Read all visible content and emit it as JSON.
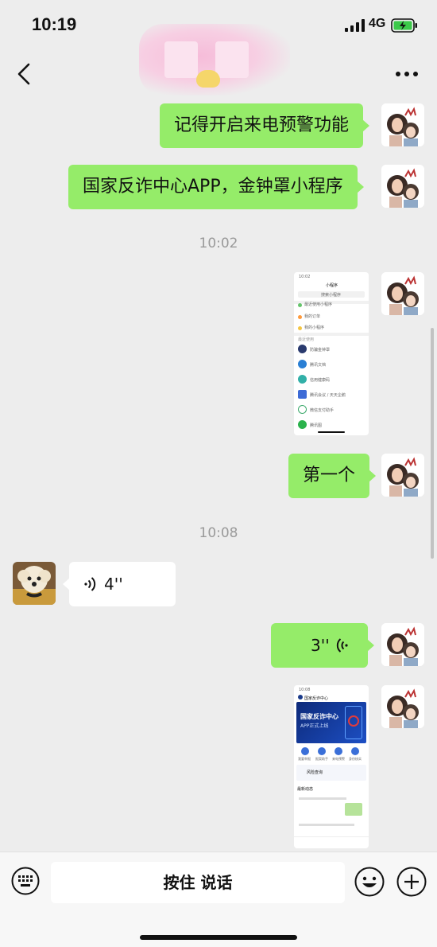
{
  "status_bar": {
    "time": "10:19",
    "network": "4G"
  },
  "header": {
    "back_icon": "chevron-left-icon",
    "more_icon": "ellipsis-icon"
  },
  "messages": [
    {
      "text": "记得开启来电预警功能"
    },
    {
      "text": "国家反诈中心APP，金钟罩小程序"
    },
    {
      "timestamp": "10:02"
    },
    {
      "text": "第一个"
    },
    {
      "timestamp": "10:08"
    },
    {
      "voice_duration": "4''"
    },
    {
      "voice_duration": "3''"
    }
  ],
  "shot1": {
    "time": "10:02",
    "title": "小程序",
    "search": "搜索小程序",
    "items": [
      "最近使用小程序",
      "我的订单",
      "我的小程序"
    ],
    "section": "最近使用",
    "apps": [
      "防骗金钟罩",
      "腾讯文档",
      "信用健康码",
      "腾讯会议 / 天天企鹅",
      "微信支付助手",
      "腾讯图"
    ]
  },
  "shot2": {
    "time": "10:08",
    "title": "国家反诈中心",
    "banner_title": "国家反诈中心",
    "banner_sub": "APP正式上线",
    "tiles": [
      "我要举报",
      "报案助手",
      "来电预警",
      "身份核实"
    ],
    "risk_title": "风险查询",
    "news_title": "最新动态"
  },
  "input": {
    "talk_label": "按住 说话"
  },
  "colors": {
    "my_bubble": "#95ec69",
    "their_bubble": "#ffffff",
    "background": "#ededed"
  }
}
